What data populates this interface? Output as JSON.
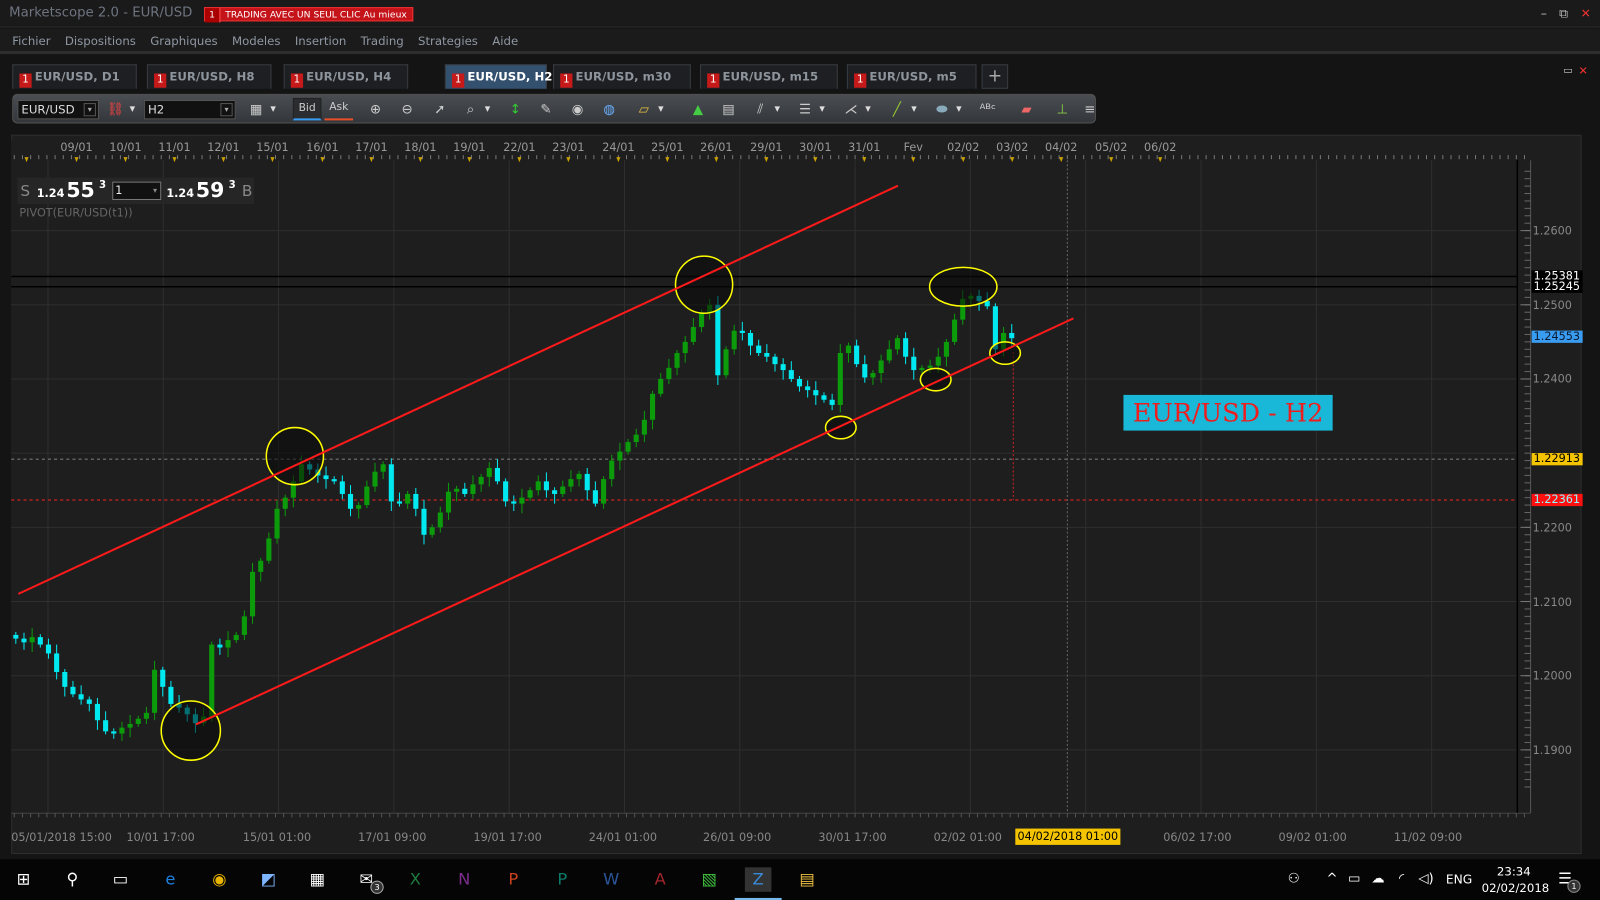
{
  "window": {
    "title": "Marketscope 2.0 - EUR/USD",
    "promo_number": "1",
    "promo_text": "TRADING AVEC UN SEUL CLIC Au mieux",
    "minimize": "–",
    "restore": "⧉",
    "close": "✕"
  },
  "menu": [
    "Fichier",
    "Dispositions",
    "Graphiques",
    "Modeles",
    "Insertion",
    "Trading",
    "Strategies",
    "Aide"
  ],
  "tabs": [
    {
      "badge": "1",
      "label": "EUR/USD, D1",
      "active": false
    },
    {
      "badge": "1",
      "label": "EUR/USD, H8",
      "active": false
    },
    {
      "badge": "1",
      "label": "EUR/USD, H4",
      "active": false
    },
    {
      "badge": "1",
      "label": "EUR/USD, H2",
      "active": true,
      "close": "✕"
    },
    {
      "badge": "1",
      "label": "EUR/USD, m30",
      "active": false
    },
    {
      "badge": "1",
      "label": "EUR/USD, m15",
      "active": false
    },
    {
      "badge": "1",
      "label": "EUR/USD, m5",
      "active": false
    }
  ],
  "tab_add": "+",
  "toolbar": {
    "instrument": "EUR/USD",
    "timeframe": "H2",
    "bid": "Bid",
    "ask": "Ask",
    "icons": [
      "unlink-icon",
      "chart-type-icon",
      "zoom-in-icon",
      "zoom-out-icon",
      "cursor-icon",
      "zoom-region-icon",
      "fit-vertical-icon",
      "properties-icon",
      "eye-icon",
      "globe-icon",
      "ruler-icon",
      "add-chart-icon",
      "window-icon",
      "pitchfork-icon",
      "list-icon",
      "fan-icon",
      "line-icon",
      "ellipse-icon",
      "text-icon",
      "eraser-icon",
      "hierarchy-icon",
      "more-icon"
    ]
  },
  "quote": {
    "sell_label": "S",
    "sell_big": "1.24",
    "sell_pips": "55",
    "sell_frac": "3",
    "amount": "1",
    "buy_big": "1.24",
    "buy_pips": "59",
    "buy_frac": "3",
    "buy_label": "B"
  },
  "indicator_label": "PIVOT(EUR/USD(t1))",
  "annotation_label": "EUR/USD - H2",
  "chart_data": {
    "type": "candlestick",
    "ylim": [
      1.185,
      1.268
    ],
    "y_ticks": [
      "1.2600",
      "1.2500",
      "1.2400",
      "1.2200",
      "1.2100",
      "1.2000",
      "1.1900"
    ],
    "top_date_ticks": [
      "09/01",
      "10/01",
      "11/01",
      "12/01",
      "15/01",
      "16/01",
      "17/01",
      "18/01",
      "19/01",
      "22/01",
      "23/01",
      "24/01",
      "25/01",
      "26/01",
      "29/01",
      "30/01",
      "31/01",
      "Fev",
      "02/02",
      "03/02",
      "04/02",
      "05/02",
      "06/02"
    ],
    "bottom_date_ticks": [
      "05/01/2018 15:00",
      "10/01 17:00",
      "15/01 01:00",
      "17/01 09:00",
      "19/01 17:00",
      "24/01 01:00",
      "26/01 09:00",
      "30/01 17:00",
      "02/02 01:00",
      "06/02 17:00",
      "09/02 01:00",
      "11/02 09:00"
    ],
    "cursor_time": "04/02/2018 01:00",
    "price_markers": [
      {
        "value": "1.25381",
        "bg": "#000000",
        "fg": "#ffffff"
      },
      {
        "value": "1.25245",
        "bg": "#000000",
        "fg": "#ffffff"
      },
      {
        "value": "1.24553",
        "bg": "#3a9cf0",
        "fg": "#0a1a30"
      },
      {
        "value": "1.22913",
        "bg": "#f5c400",
        "fg": "#000000"
      },
      {
        "value": "1.22361",
        "bg": "#ff1010",
        "fg": "#8ff8ff"
      }
    ],
    "up_color": "#0b9b0b",
    "down_color": "#00e8f0",
    "close": [
      1.205,
      1.2045,
      1.2052,
      1.2042,
      1.203,
      1.2005,
      1.1985,
      1.1975,
      1.1968,
      1.1962,
      1.194,
      1.1925,
      1.1922,
      1.193,
      1.1935,
      1.1942,
      1.195,
      1.2008,
      1.1985,
      1.1962,
      1.1957,
      1.1948,
      1.1936,
      1.1945,
      1.2042,
      1.2038,
      1.2048,
      1.2055,
      1.208,
      1.214,
      1.2155,
      1.2185,
      1.2225,
      1.224,
      1.2262,
      1.2285,
      1.2278,
      1.227,
      1.2265,
      1.2262,
      1.2245,
      1.2225,
      1.223,
      1.2255,
      1.2275,
      1.2285,
      1.2235,
      1.2232,
      1.2245,
      1.2225,
      1.219,
      1.22,
      1.222,
      1.2248,
      1.2252,
      1.2245,
      1.2258,
      1.2268,
      1.228,
      1.2262,
      1.2235,
      1.2232,
      1.224,
      1.225,
      1.2262,
      1.225,
      1.2245,
      1.2255,
      1.2265,
      1.2272,
      1.225,
      1.2232,
      1.2265,
      1.229,
      1.2302,
      1.2315,
      1.2325,
      1.2345,
      1.238,
      1.24,
      1.2415,
      1.2435,
      1.245,
      1.247,
      1.249,
      1.25,
      1.2405,
      1.244,
      1.2465,
      1.2462,
      1.2445,
      1.2435,
      1.243,
      1.242,
      1.2412,
      1.24,
      1.239,
      1.2385,
      1.2378,
      1.2372,
      1.2365,
      1.2435,
      1.2445,
      1.242,
      1.2402,
      1.2408,
      1.2425,
      1.244,
      1.2455,
      1.243,
      1.2412,
      1.2415,
      1.2418,
      1.243,
      1.245,
      1.248,
      1.2508,
      1.2512,
      1.2505,
      1.2498,
      1.244,
      1.2462,
      1.2455
    ],
    "trendline_color": "#ff1a1a",
    "highlight_color": "#ffff00"
  },
  "taskbar": {
    "apps": [
      {
        "name": "start-icon",
        "glyph": "⊞"
      },
      {
        "name": "search-icon",
        "glyph": "⚲"
      },
      {
        "name": "task-view-icon",
        "glyph": "▭"
      },
      {
        "name": "edge-icon",
        "glyph": "e",
        "color": "#1e7fe0"
      },
      {
        "name": "chrome-icon",
        "glyph": "◉",
        "color": "#e9b400"
      },
      {
        "name": "app-icon",
        "glyph": "◩",
        "color": "#7fb4ff"
      },
      {
        "name": "calendar-icon",
        "glyph": "▦"
      },
      {
        "name": "mail-icon",
        "glyph": "✉",
        "badge": "3"
      },
      {
        "name": "excel-icon",
        "glyph": "X",
        "color": "#1d7a3e"
      },
      {
        "name": "onenote-icon",
        "glyph": "N",
        "color": "#7b2d8c"
      },
      {
        "name": "powerpoint-icon",
        "glyph": "P",
        "color": "#c9421f"
      },
      {
        "name": "publisher-icon",
        "glyph": "P",
        "color": "#0b7a6a"
      },
      {
        "name": "word-icon",
        "glyph": "W",
        "color": "#2a5699"
      },
      {
        "name": "access-icon",
        "glyph": "A",
        "color": "#a4262c"
      },
      {
        "name": "color-app-icon",
        "glyph": "▧",
        "color": "#40c040"
      },
      {
        "name": "marketscope-icon",
        "glyph": "Z",
        "color": "#3a8ad8",
        "active": true
      },
      {
        "name": "file-explorer-icon",
        "glyph": "▤",
        "color": "#f0c040"
      }
    ],
    "tray": {
      "lang": "ENG",
      "time": "23:34",
      "date": "02/02/2018",
      "notifications": "1"
    }
  }
}
